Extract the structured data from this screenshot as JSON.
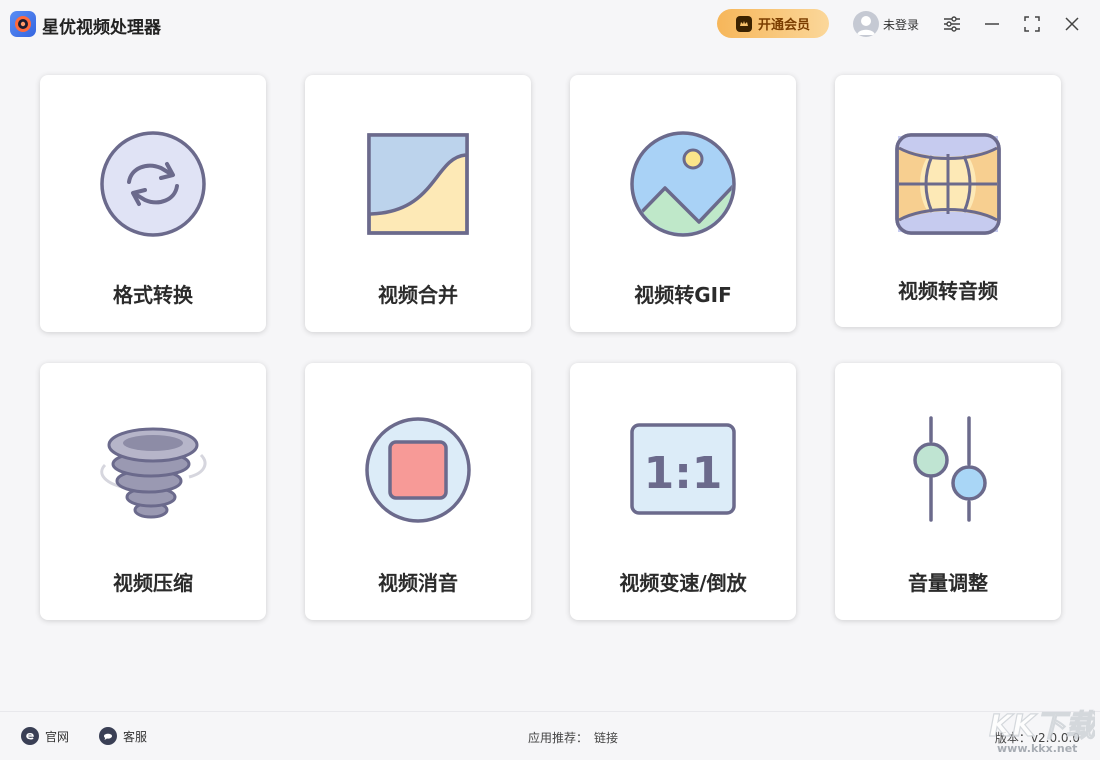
{
  "app": {
    "title": "星优视频处理器",
    "vip_label": "开通会员",
    "user_label": "未登录"
  },
  "cards": [
    {
      "label": "格式转换",
      "icon": "convert-icon"
    },
    {
      "label": "视频合并",
      "icon": "merge-icon"
    },
    {
      "label": "视频转GIF",
      "icon": "image-icon"
    },
    {
      "label": "视频转音频",
      "icon": "panorama-icon"
    },
    {
      "label": "视频压缩",
      "icon": "tornado-icon"
    },
    {
      "label": "视频消音",
      "icon": "stop-icon"
    },
    {
      "label": "视频变速/倒放",
      "icon": "ratio-icon"
    },
    {
      "label": "音量调整",
      "icon": "sliders-icon"
    }
  ],
  "ratio_text": "1:1",
  "footer": {
    "website_label": "官网",
    "support_label": "客服",
    "recommend_label": "应用推荐：",
    "recommend_link": "链接",
    "version": "版本：v2.0.0.0"
  },
  "watermark": {
    "logo_text": "KK下载",
    "url": "www.kkx.net"
  },
  "colors": {
    "background": "#f6f6f8",
    "vip_gradient_start": "#f6b65a",
    "vip_gradient_end": "#fbd79a",
    "icon_stroke": "#6b6a8c"
  }
}
